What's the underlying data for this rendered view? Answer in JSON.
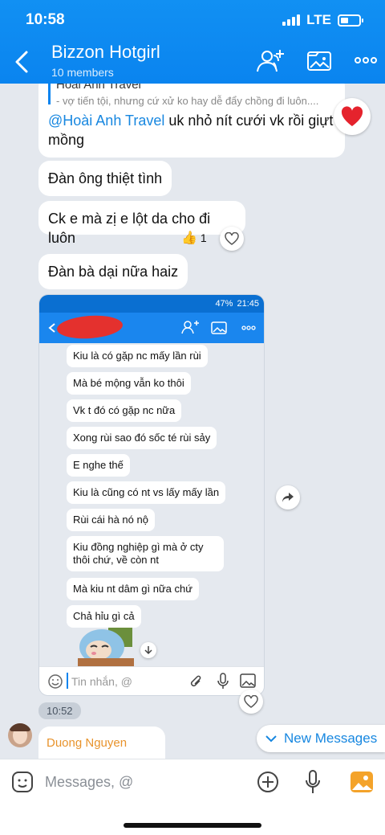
{
  "status": {
    "time": "10:58",
    "network": "LTE"
  },
  "header": {
    "title": "Bizzon Hotgirl",
    "subtitle": "10 members",
    "icons": [
      "back-icon",
      "add-member-icon",
      "gallery-icon",
      "more-icon"
    ]
  },
  "messages": {
    "reply_name": "Hoài Anh Travel",
    "reply_quote": "- vợ tiến tội, nhưng cứ xử ko hay dễ đẩy chồng đi luôn....",
    "m1_mention": "@Hoài Anh Travel",
    "m1_text": " uk nhỏ nít cưới vk rồi giựt mồng",
    "m2": "Đàn ông thiệt tình",
    "m3": "Ck e mà zị e lột da cho đi luôn",
    "m3_reaction_count": "1",
    "m4": "Đàn bà dại nữa haiz"
  },
  "screenshot": {
    "battery": "47%",
    "time": "21:45",
    "lines": [
      "Kiu là có gặp nc mấy lần rùi",
      "Mà bé mộng vẫn ko thôi",
      "Vk t đó có gặp nc nữa",
      "Xong rùi sao đó sốc té rùi sảy",
      "E nghe thế",
      "Kiu là cũng có nt vs lấy mấy lần",
      "Rùi cái hà nó nộ",
      "Kiu đồng nghiệp gì mà ở cty thôi chứ, về còn nt",
      "Mà kiu nt dâm gì nữa chứ",
      "Chả hỉu gì cả"
    ],
    "input_placeholder": "Tin nhắn, @"
  },
  "time_pill": "10:52",
  "sender_name": "Duong Nguyen",
  "new_messages": "New Messages",
  "composer": {
    "placeholder": "Messages, @"
  },
  "colors": {
    "accent": "#0a84ef",
    "mention": "#1787e0",
    "sender": "#e8932c"
  }
}
